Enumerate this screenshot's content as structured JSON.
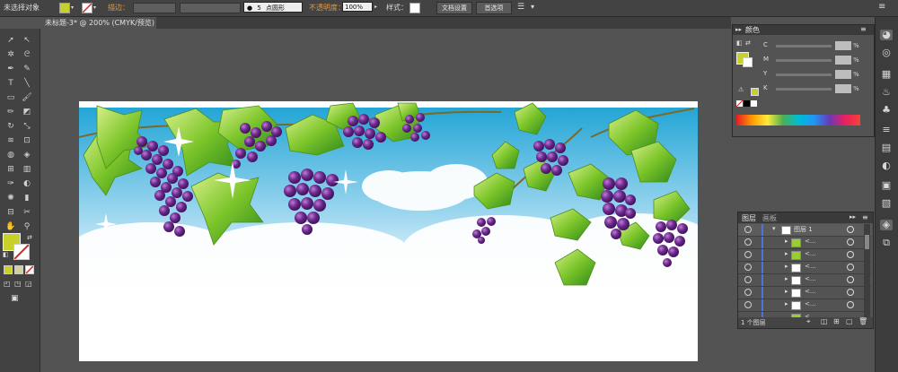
{
  "control_bar": {
    "selection_status": "未选择对象",
    "stroke_label": "描边：",
    "brush_size": "5",
    "brush_shape": "点圆形",
    "opacity_label": "不透明度：",
    "opacity_value": "100%",
    "style_label": "样式：",
    "doc_setup_button": "文档设置",
    "preferences_button": "首选项"
  },
  "document": {
    "tab_title": "未标题-3* @ 200% (CMYK/预览)"
  },
  "color_panel": {
    "title": "颜色",
    "channels": [
      {
        "label": "C",
        "value": "",
        "unit": "%"
      },
      {
        "label": "M",
        "value": "",
        "unit": "%"
      },
      {
        "label": "Y",
        "value": "",
        "unit": "%"
      },
      {
        "label": "K",
        "value": "",
        "unit": "%"
      }
    ]
  },
  "layers_panel": {
    "tabs": [
      "图层",
      "画板"
    ],
    "top_layer": "图层 1",
    "sublayers": [
      "<...",
      "<...",
      "<...",
      "<...",
      "<...",
      "<...",
      "<..."
    ],
    "footer_count": "1 个图层"
  },
  "colors": {
    "fill_swatch": "#c7d12a",
    "sky": "#3aa9d6",
    "grape": "#6b2a8c",
    "leaf": "#7cc52a"
  }
}
